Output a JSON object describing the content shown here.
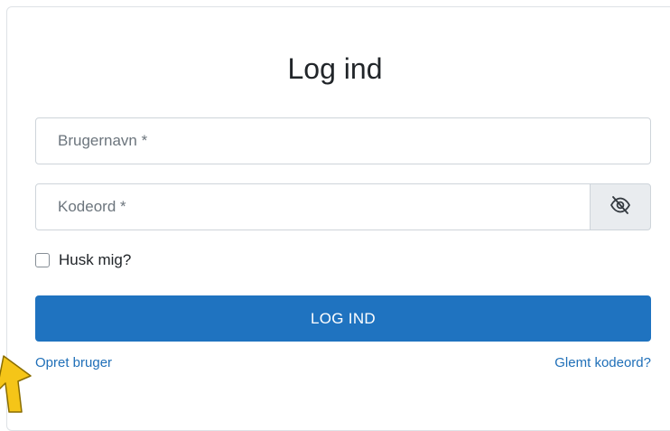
{
  "login": {
    "title": "Log ind",
    "username_placeholder": "Brugernavn *",
    "password_placeholder": "Kodeord *",
    "remember_label": "Husk mig?",
    "submit_label": "LOG IND",
    "register_link": "Opret bruger",
    "forgot_link": "Glemt kodeord?"
  },
  "icons": {
    "password_toggle": "eye-slash-icon",
    "cursor": "pointer-arrow-icon"
  },
  "colors": {
    "primary": "#1f73c0",
    "link": "#1f6fb8",
    "cursor": "#f5c518"
  }
}
